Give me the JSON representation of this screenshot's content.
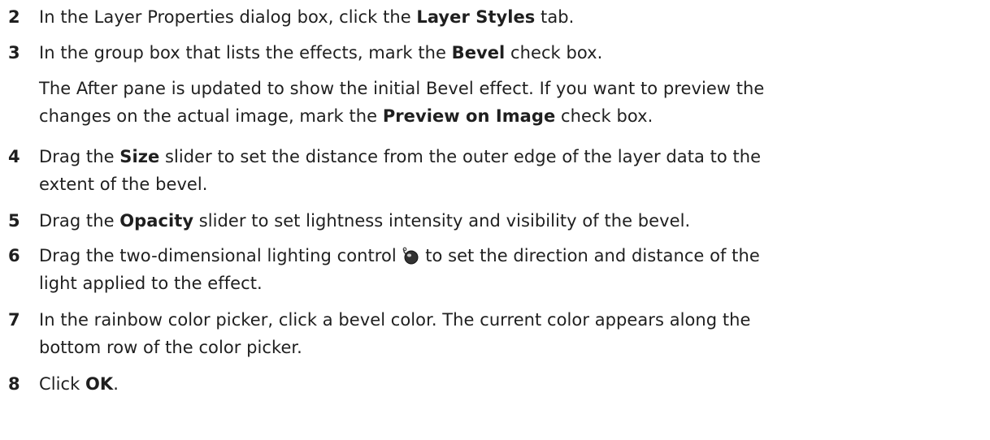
{
  "steps": [
    {
      "number": "2",
      "parts": [
        "In the Layer Properties dialog box, click the ",
        "Layer Styles",
        " tab."
      ]
    },
    {
      "number": "3",
      "parts": [
        "In the group box that lists the effects, mark the ",
        "Bevel",
        " check box."
      ],
      "note": {
        "line1": "The After pane is updated to show the initial Bevel effect. If you want to preview the",
        "line2_parts": [
          "changes on the actual image, mark the ",
          "Preview on Image",
          " check box."
        ]
      }
    },
    {
      "number": "4",
      "parts": [
        "Drag the ",
        "Size",
        " slider to set the distance from the outer edge of the layer data to the"
      ],
      "line2": "extent of the bevel."
    },
    {
      "number": "5",
      "parts": [
        "Drag the ",
        "Opacity",
        " slider to set lightness intensity and visibility of the bevel."
      ]
    },
    {
      "number": "6",
      "parts": [
        "Drag the two-dimensional lighting control ",
        " to set the direction and distance of the"
      ],
      "line2": "light applied to the effect.",
      "icon": "lighting-control-icon"
    },
    {
      "number": "7",
      "line1": "In the rainbow color picker, click a bevel color. The current color appears along the",
      "line2": "bottom row of the color picker."
    },
    {
      "number": "8",
      "parts": [
        "Click ",
        "OK",
        "."
      ]
    }
  ]
}
